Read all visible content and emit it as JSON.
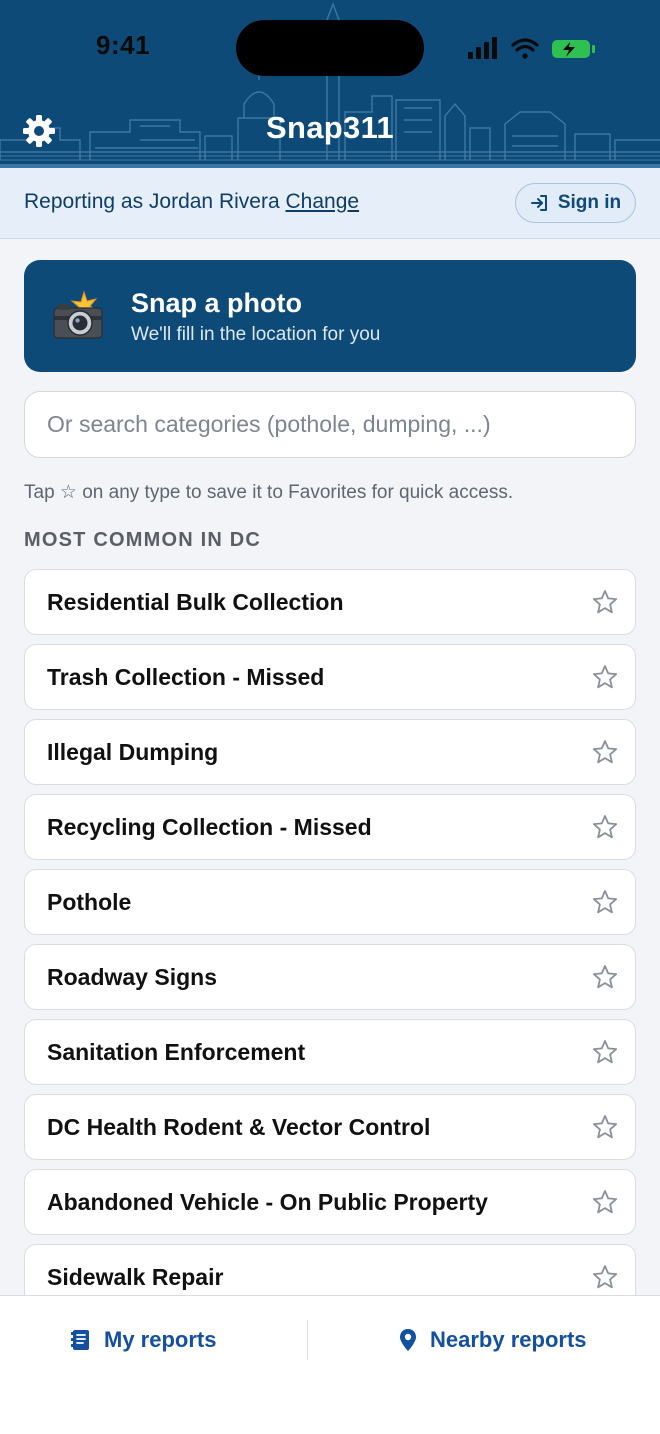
{
  "status_bar": {
    "time": "9:41"
  },
  "header": {
    "title": "Snap311"
  },
  "identity": {
    "prefix": "Reporting as Jordan Rivera",
    "change_link": "Change",
    "signin_label": "Sign in"
  },
  "snap_card": {
    "title": "Snap a photo",
    "subtitle": "We'll fill in the location for you"
  },
  "search": {
    "placeholder": "Or search categories (pothole, dumping, ...)",
    "value": ""
  },
  "hint": "Tap ☆ on any type to save it to Favorites for quick access.",
  "section_label": "MOST COMMON IN DC",
  "categories": [
    {
      "label": "Residential Bulk Collection",
      "favorite": false
    },
    {
      "label": "Trash Collection - Missed",
      "favorite": false
    },
    {
      "label": "Illegal Dumping",
      "favorite": false
    },
    {
      "label": "Recycling Collection - Missed",
      "favorite": false
    },
    {
      "label": "Pothole",
      "favorite": false
    },
    {
      "label": "Roadway Signs",
      "favorite": false
    },
    {
      "label": "Sanitation Enforcement",
      "favorite": false
    },
    {
      "label": "DC Health Rodent & Vector Control",
      "favorite": false
    },
    {
      "label": "Abandoned Vehicle - On Public Property",
      "favorite": false
    },
    {
      "label": "Sidewalk Repair",
      "favorite": false
    }
  ],
  "tabbar": {
    "my_reports": "My reports",
    "nearby_reports": "Nearby reports"
  },
  "colors": {
    "brand": "#0d4a77",
    "accent": "#1450a0",
    "background": "#f2f4f7"
  },
  "icons": {
    "settings": "gear-icon",
    "sign_in": "sign-in-icon",
    "camera": "camera-flash-icon",
    "star": "star-outline-icon",
    "my_reports": "document-icon",
    "nearby": "map-pin-icon"
  }
}
